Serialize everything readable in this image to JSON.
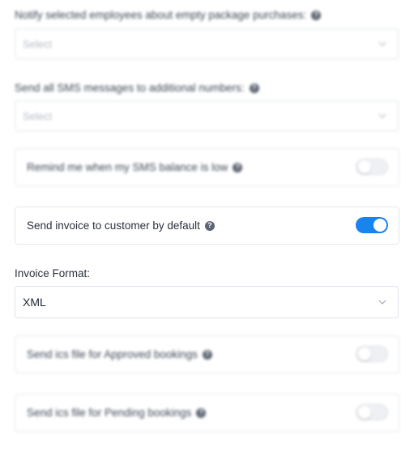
{
  "notify_empty_package": {
    "label": "Notify selected employees about empty package purchases:",
    "placeholder": "Select"
  },
  "sms_additional": {
    "label": "Send all SMS messages to additional numbers:",
    "placeholder": "Select"
  },
  "remind_sms_low": {
    "label": "Remind me when my SMS balance is low",
    "enabled": false
  },
  "send_invoice": {
    "label": "Send invoice to customer by default",
    "enabled": true
  },
  "invoice_format": {
    "label": "Invoice Format:",
    "value": "XML"
  },
  "ics_approved": {
    "label": "Send ics file for Approved bookings",
    "enabled": false
  },
  "ics_pending": {
    "label": "Send ics file for Pending bookings",
    "enabled": false
  },
  "colors": {
    "toggle_on": "#1a84ee",
    "toggle_off": "#eef0f3"
  },
  "icons": {
    "help": "help-circle-icon",
    "dropdown": "chevron-down-icon"
  }
}
